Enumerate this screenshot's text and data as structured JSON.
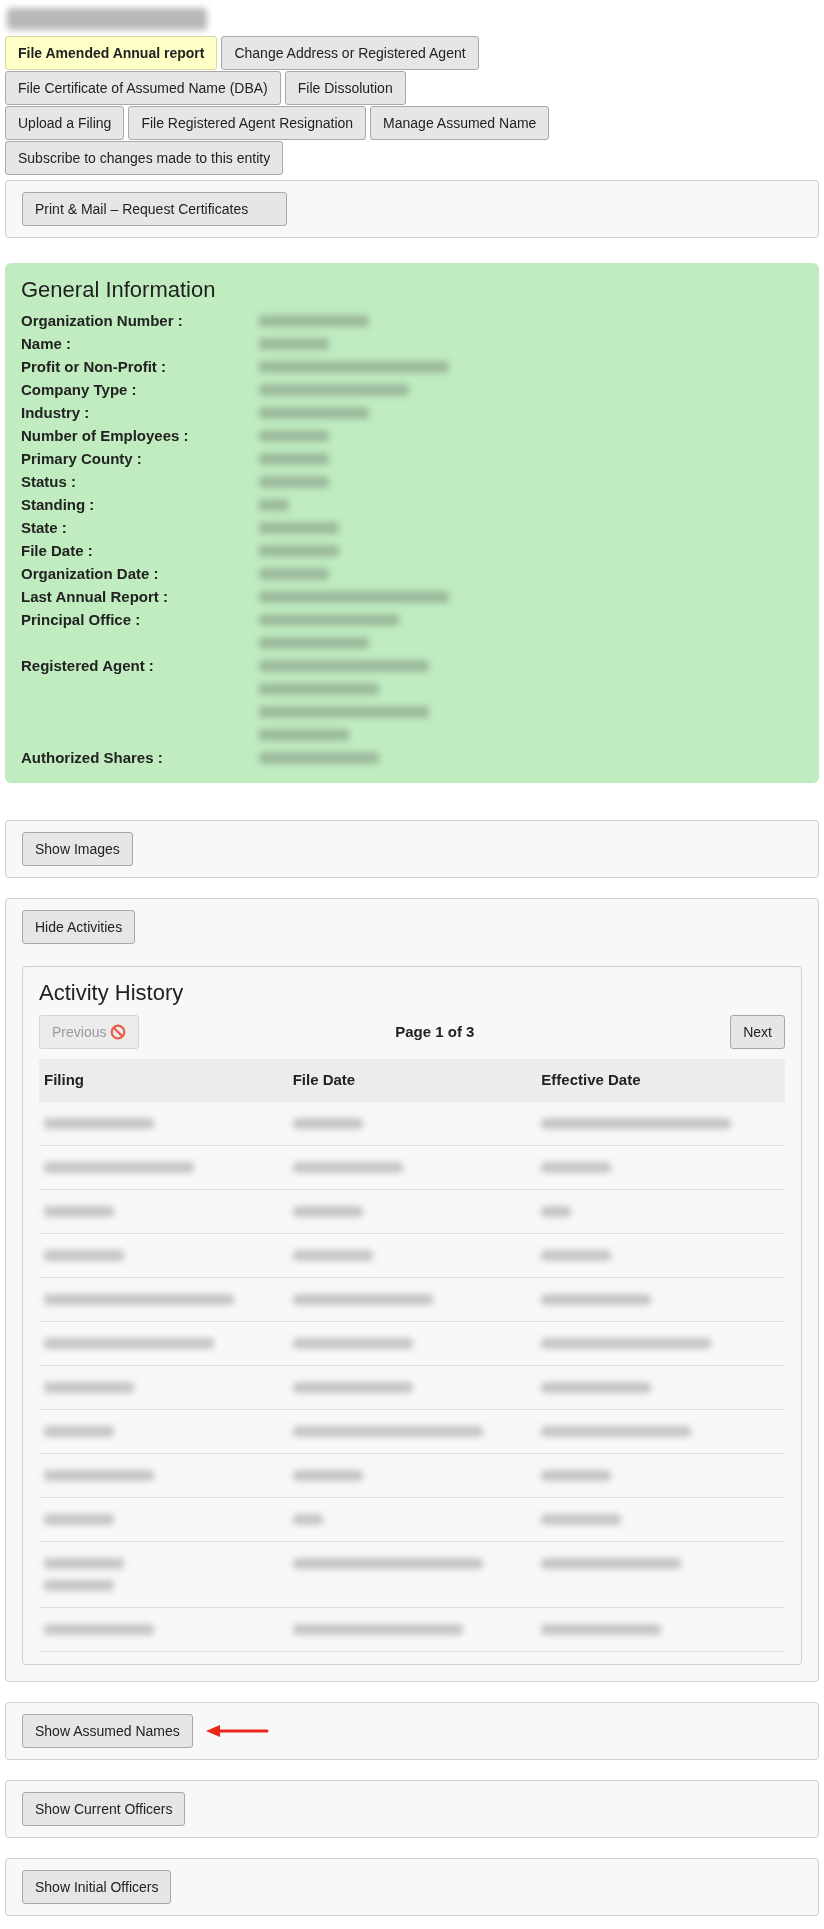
{
  "entity_title": {
    "kind": "redacted"
  },
  "action_button_rows": [
    [
      {
        "label": "File Amended Annual report",
        "highlighted": true
      },
      {
        "label": "Change Address or Registered Agent",
        "highlighted": false
      }
    ],
    [
      {
        "label": "File Certificate of Assumed Name (DBA)",
        "highlighted": false
      },
      {
        "label": "File Dissolution",
        "highlighted": false
      }
    ],
    [
      {
        "label": "Upload a Filing",
        "highlighted": false
      },
      {
        "label": "File Registered Agent Resignation",
        "highlighted": false
      },
      {
        "label": "Manage Assumed Name",
        "highlighted": false
      }
    ],
    [
      {
        "label": "Subscribe to changes made to this entity",
        "highlighted": false
      }
    ]
  ],
  "print_button": "Print & Mail – Request Certificates",
  "general_information": {
    "title": "General Information",
    "fields": [
      {
        "label": "Organization Number :",
        "value_lines": [
          {
            "kind": "redacted"
          }
        ]
      },
      {
        "label": "Name :",
        "value_lines": [
          {
            "kind": "redacted"
          }
        ]
      },
      {
        "label": "Profit or Non-Profit :",
        "value_lines": [
          {
            "kind": "redacted"
          }
        ]
      },
      {
        "label": "Company Type :",
        "value_lines": [
          {
            "kind": "redacted"
          }
        ]
      },
      {
        "label": "Industry :",
        "value_lines": [
          {
            "kind": "redacted"
          }
        ]
      },
      {
        "label": "Number of Employees :",
        "value_lines": [
          {
            "kind": "redacted"
          }
        ]
      },
      {
        "label": "Primary County :",
        "value_lines": [
          {
            "kind": "redacted"
          }
        ]
      },
      {
        "label": "Status :",
        "value_lines": [
          {
            "kind": "redacted"
          }
        ]
      },
      {
        "label": "Standing :",
        "value_lines": [
          {
            "kind": "redacted"
          }
        ]
      },
      {
        "label": "State :",
        "value_lines": [
          {
            "kind": "redacted"
          }
        ]
      },
      {
        "label": "File Date :",
        "value_lines": [
          {
            "kind": "redacted"
          }
        ]
      },
      {
        "label": "Organization Date :",
        "value_lines": [
          {
            "kind": "redacted"
          }
        ]
      },
      {
        "label": "Last Annual Report :",
        "value_lines": [
          {
            "kind": "redacted"
          }
        ]
      },
      {
        "label": "Principal Office :",
        "value_lines": [
          {
            "kind": "redacted"
          },
          {
            "kind": "redacted"
          }
        ]
      },
      {
        "label": "Registered Agent :",
        "value_lines": [
          {
            "kind": "redacted"
          },
          {
            "kind": "redacted"
          },
          {
            "kind": "redacted"
          },
          {
            "kind": "redacted"
          }
        ]
      },
      {
        "label": "Authorized Shares :",
        "value_lines": [
          {
            "kind": "redacted"
          }
        ]
      }
    ]
  },
  "images_button": "Show Images",
  "activities": {
    "toggle_button": "Hide Activities",
    "title": "Activity History",
    "previous_button": {
      "label": "Previous",
      "disabled": true
    },
    "page_label": "Page 1 of 3",
    "next_button": {
      "label": "Next",
      "disabled": false
    },
    "columns": [
      "Filing",
      "File Date",
      "Effective Date"
    ],
    "rows": [
      {
        "cells": [
          [
            {
              "kind": "redacted"
            }
          ],
          [
            {
              "kind": "redacted"
            }
          ],
          [
            {
              "kind": "redacted"
            }
          ]
        ]
      },
      {
        "cells": [
          [
            {
              "kind": "redacted"
            }
          ],
          [
            {
              "kind": "redacted"
            }
          ],
          [
            {
              "kind": "redacted"
            }
          ]
        ]
      },
      {
        "cells": [
          [
            {
              "kind": "redacted"
            }
          ],
          [
            {
              "kind": "redacted"
            }
          ],
          [
            {
              "kind": "redacted"
            }
          ]
        ]
      },
      {
        "cells": [
          [
            {
              "kind": "redacted"
            }
          ],
          [
            {
              "kind": "redacted"
            }
          ],
          [
            {
              "kind": "redacted"
            }
          ]
        ]
      },
      {
        "cells": [
          [
            {
              "kind": "redacted"
            }
          ],
          [
            {
              "kind": "redacted"
            }
          ],
          [
            {
              "kind": "redacted"
            }
          ]
        ]
      },
      {
        "cells": [
          [
            {
              "kind": "redacted"
            }
          ],
          [
            {
              "kind": "redacted"
            }
          ],
          [
            {
              "kind": "redacted"
            }
          ]
        ]
      },
      {
        "cells": [
          [
            {
              "kind": "redacted"
            }
          ],
          [
            {
              "kind": "redacted"
            }
          ],
          [
            {
              "kind": "redacted"
            }
          ]
        ]
      },
      {
        "cells": [
          [
            {
              "kind": "redacted"
            }
          ],
          [
            {
              "kind": "redacted"
            }
          ],
          [
            {
              "kind": "redacted"
            }
          ]
        ]
      },
      {
        "cells": [
          [
            {
              "kind": "redacted"
            }
          ],
          [
            {
              "kind": "redacted"
            }
          ],
          [
            {
              "kind": "redacted"
            }
          ]
        ]
      },
      {
        "cells": [
          [
            {
              "kind": "redacted"
            }
          ],
          [
            {
              "kind": "redacted"
            }
          ],
          [
            {
              "kind": "redacted"
            }
          ]
        ]
      },
      {
        "cells": [
          [
            {
              "kind": "redacted"
            },
            {
              "kind": "redacted"
            }
          ],
          [
            {
              "kind": "redacted"
            }
          ],
          [
            {
              "kind": "redacted"
            }
          ]
        ]
      },
      {
        "cells": [
          [
            {
              "kind": "redacted"
            }
          ],
          [
            {
              "kind": "redacted"
            }
          ],
          [
            {
              "kind": "redacted"
            }
          ]
        ]
      }
    ]
  },
  "sections": [
    {
      "button": "Show Assumed Names",
      "pointer_arrow": true
    },
    {
      "button": "Show Current Officers",
      "pointer_arrow": false
    },
    {
      "button": "Show Initial Officers",
      "pointer_arrow": false
    }
  ]
}
